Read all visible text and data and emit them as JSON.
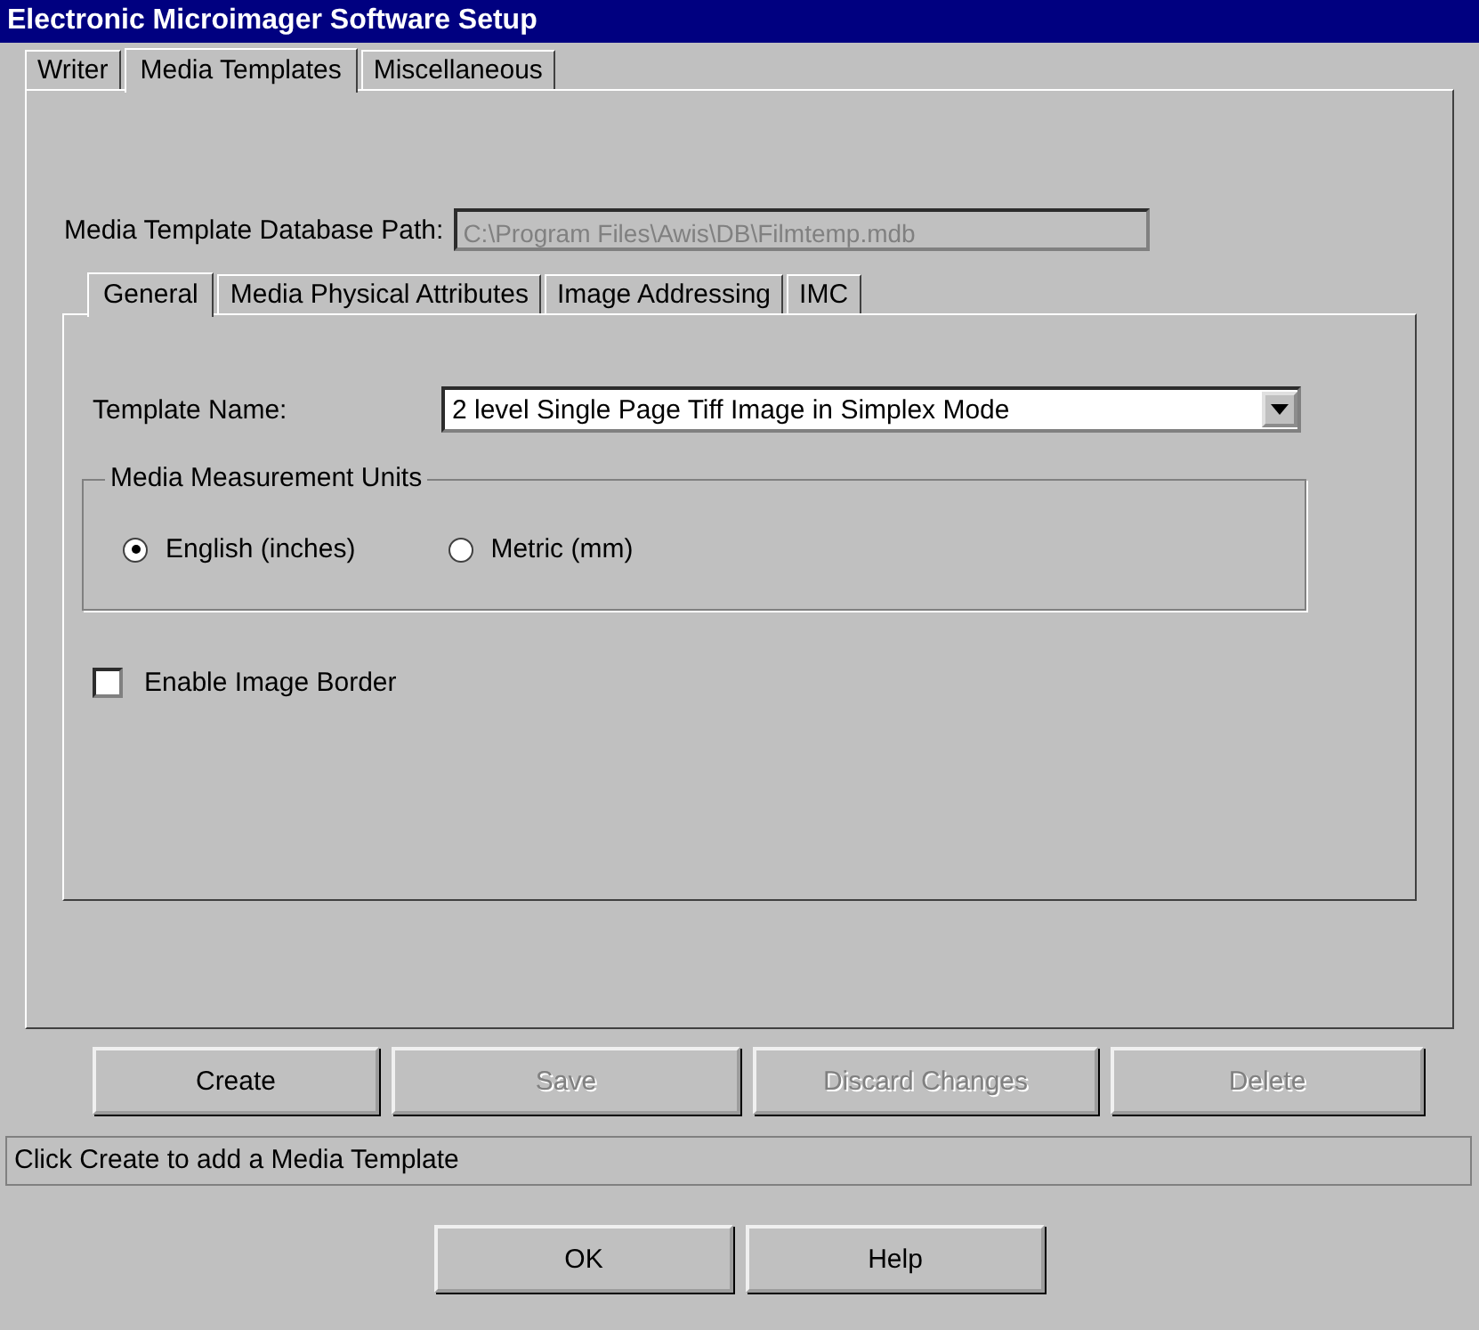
{
  "window": {
    "title": "Electronic Microimager Software Setup"
  },
  "tabs": [
    {
      "label": "Writer",
      "selected": false
    },
    {
      "label": "Media Templates",
      "selected": true
    },
    {
      "label": "Miscellaneous",
      "selected": false
    }
  ],
  "database_path": {
    "label": "Media Template Database Path:",
    "value": "C:\\Program Files\\Awis\\DB\\Filmtemp.mdb",
    "disabled": true
  },
  "inner_tabs": [
    {
      "label": "General",
      "selected": true
    },
    {
      "label": "Media Physical Attributes",
      "selected": false
    },
    {
      "label": "Image Addressing",
      "selected": false
    },
    {
      "label": "IMC",
      "selected": false
    }
  ],
  "template_name": {
    "label": "Template Name:",
    "value": "2 level Single Page Tiff Image in Simplex Mode"
  },
  "units_group": {
    "title": "Media Measurement Units",
    "options": [
      {
        "label": "English (inches)",
        "selected": true
      },
      {
        "label": "Metric (mm)",
        "selected": false
      }
    ]
  },
  "enable_border": {
    "label": "Enable Image Border",
    "checked": false
  },
  "buttons": [
    {
      "label": "Create",
      "disabled": false
    },
    {
      "label": "Save",
      "disabled": true
    },
    {
      "label": "Discard Changes",
      "disabled": true
    },
    {
      "label": "Delete",
      "disabled": true
    }
  ],
  "status_bar": "Click Create to add a Media Template",
  "dialog_buttons": [
    {
      "label": "OK",
      "disabled": false
    },
    {
      "label": "Help",
      "disabled": false
    }
  ]
}
